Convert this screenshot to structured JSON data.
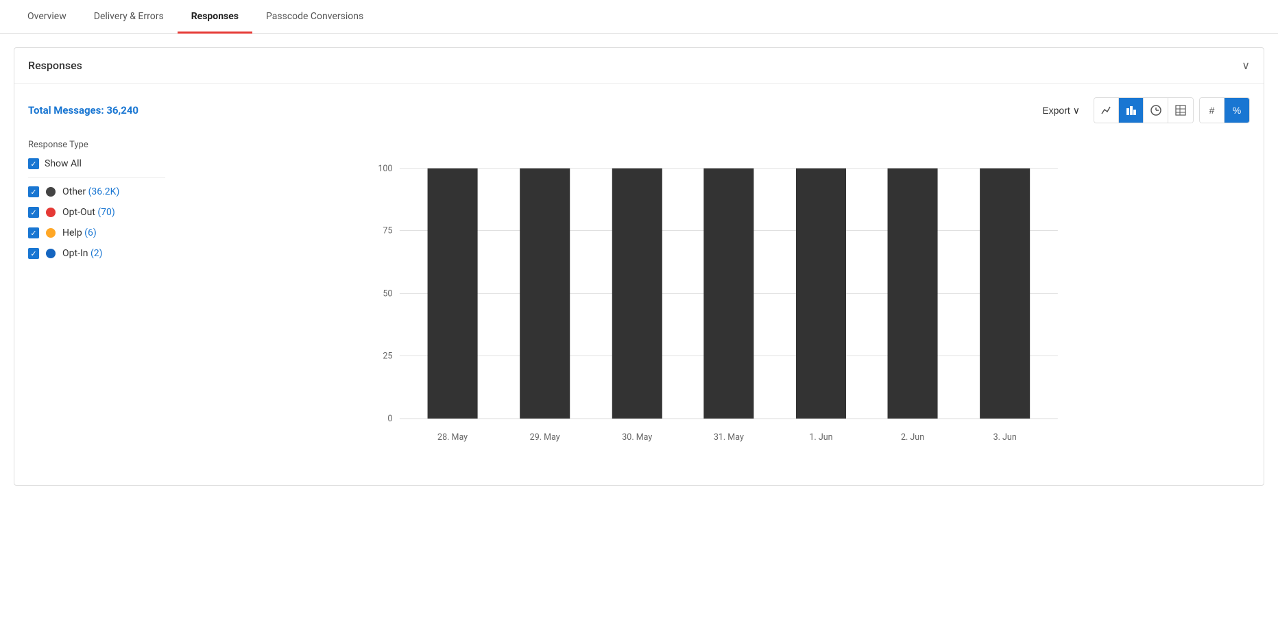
{
  "tabs": [
    {
      "label": "Overview",
      "active": false
    },
    {
      "label": "Delivery & Errors",
      "active": false
    },
    {
      "label": "Responses",
      "active": true
    },
    {
      "label": "Passcode Conversions",
      "active": false
    }
  ],
  "card": {
    "title": "Responses",
    "chevron": "∨"
  },
  "stats": {
    "label": "Total Messages:",
    "value": "36,240"
  },
  "toolbar": {
    "export_label": "Export",
    "icons": [
      {
        "name": "line-chart-icon",
        "symbol": "📈",
        "active": false
      },
      {
        "name": "bar-chart-icon",
        "symbol": "▊",
        "active": true
      },
      {
        "name": "clock-icon",
        "symbol": "⏱",
        "active": false
      },
      {
        "name": "table-icon",
        "symbol": "⊞",
        "active": false
      }
    ],
    "hash_label": "#",
    "pct_label": "%",
    "pct_active": true
  },
  "legend": {
    "response_type_label": "Response Type",
    "show_all_label": "Show All",
    "items": [
      {
        "label": "Other",
        "count": "36.2K",
        "color": "#444444"
      },
      {
        "label": "Opt-Out",
        "count": "70",
        "color": "#e53935"
      },
      {
        "label": "Help",
        "count": "6",
        "color": "#ffa726"
      },
      {
        "label": "Opt-In",
        "count": "2",
        "color": "#1565c0"
      }
    ]
  },
  "chart": {
    "y_labels": [
      "0",
      "25",
      "50",
      "75",
      "100"
    ],
    "x_labels": [
      "28. May",
      "29. May",
      "30. May",
      "31. May",
      "1. Jun",
      "2. Jun",
      "3. Jun"
    ],
    "bars": [
      100,
      100,
      100,
      100,
      100,
      100,
      100
    ]
  }
}
